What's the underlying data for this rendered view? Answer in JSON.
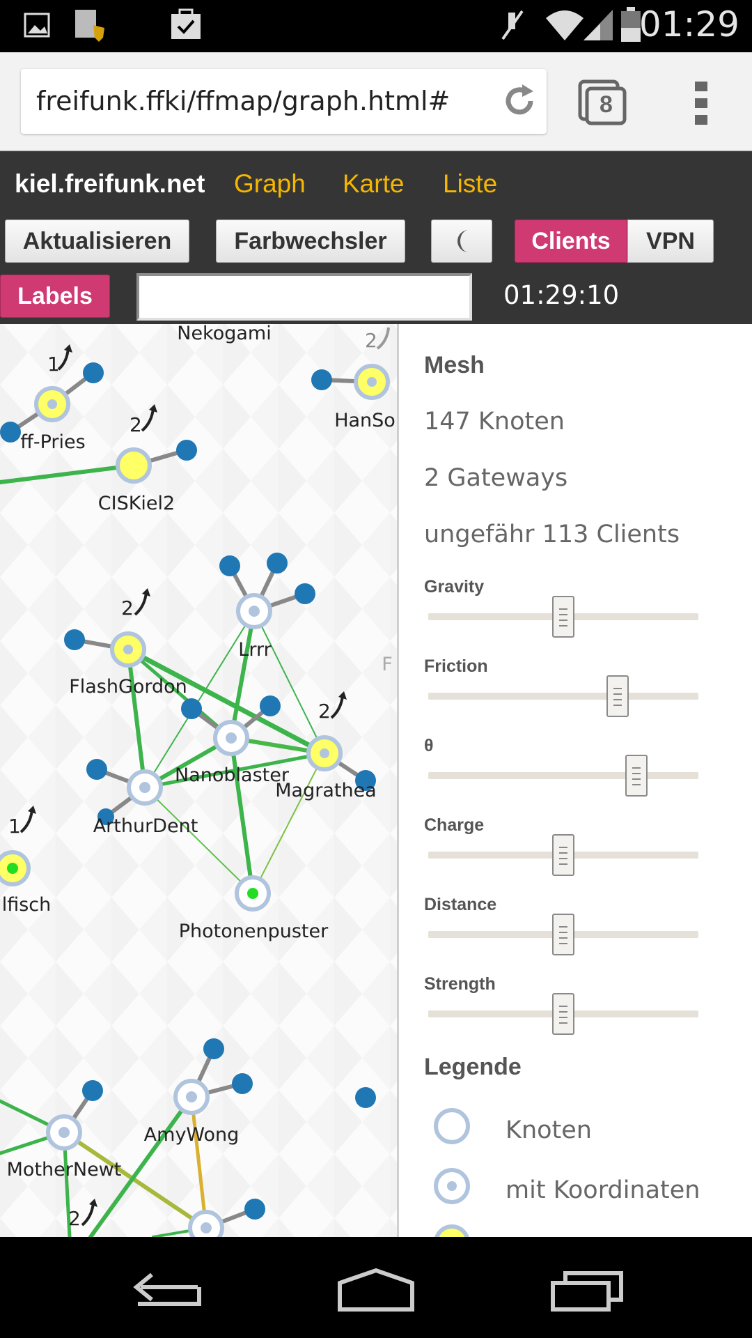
{
  "status_bar": {
    "time": "01:29"
  },
  "browser": {
    "url": "freifunk.ffki/ffmap/graph.html#",
    "tab_count": "8"
  },
  "app": {
    "brand": "kiel.freifunk.net",
    "nav": [
      "Graph",
      "Karte",
      "Liste"
    ],
    "buttons": {
      "refresh": "Aktualisieren",
      "color": "Farbwechsler",
      "clients": "Clients",
      "vpn": "VPN",
      "labels": "Labels"
    },
    "time": "01:29:10"
  },
  "graph": {
    "labels": [
      "Nekogami",
      "ff-Pries",
      "CISKiel2",
      "HanSo",
      "Lrrr",
      "FlashGordon",
      "Nanoblaster",
      "Magrathea",
      "ArthurDent",
      "Photonenpuster",
      "lfisch",
      "AmyWong",
      "MotherNewt"
    ],
    "client_badges": [
      "1",
      "2",
      "2",
      "2",
      "2",
      "1",
      "2"
    ],
    "cut_text": "F"
  },
  "panel": {
    "title": "Mesh",
    "stats": [
      "147 Knoten",
      "2 Gateways",
      "ungefähr 113 Clients"
    ],
    "sliders": [
      {
        "label": "Gravity",
        "value": 0.5
      },
      {
        "label": "Friction",
        "value": 0.7
      },
      {
        "label": "θ",
        "value": 0.77
      },
      {
        "label": "Charge",
        "value": 0.5
      },
      {
        "label": "Distance",
        "value": 0.5
      },
      {
        "label": "Strength",
        "value": 0.5
      }
    ],
    "legend_title": "Legende",
    "legend": [
      "Knoten",
      "mit Koordinaten"
    ]
  }
}
